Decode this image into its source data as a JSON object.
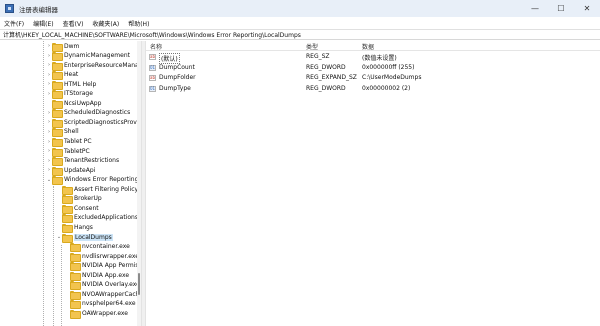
{
  "window": {
    "title": "注册表编辑器",
    "minimize": "—",
    "maximize": "☐",
    "close": "✕"
  },
  "menu": [
    "文件(F)",
    "编辑(E)",
    "查看(V)",
    "收藏夹(A)",
    "帮助(H)"
  ],
  "address": "计算机\\HKEY_LOCAL_MACHINE\\SOFTWARE\\Microsoft\\Windows\\Windows Error Reporting\\LocalDumps",
  "tree": [
    {
      "label": "Dwm",
      "level": 0,
      "expander": "›"
    },
    {
      "label": "DynamicManagement",
      "level": 0,
      "expander": "›"
    },
    {
      "label": "EnterpriseResourceManage",
      "level": 0,
      "expander": "›"
    },
    {
      "label": "Heat",
      "level": 0,
      "expander": "›"
    },
    {
      "label": "HTML Help",
      "level": 0,
      "expander": "›"
    },
    {
      "label": "ITStorage",
      "level": 0,
      "expander": "›"
    },
    {
      "label": "NcsiUwpApp",
      "level": 0,
      "expander": ""
    },
    {
      "label": "ScheduledDiagnostics",
      "level": 0,
      "expander": "›"
    },
    {
      "label": "ScriptedDiagnosticsProvide",
      "level": 0,
      "expander": "›"
    },
    {
      "label": "Shell",
      "level": 0,
      "expander": "›"
    },
    {
      "label": "Tablet PC",
      "level": 0,
      "expander": "›"
    },
    {
      "label": "TabletPC",
      "level": 0,
      "expander": "›"
    },
    {
      "label": "TenantRestrictions",
      "level": 0,
      "expander": "›"
    },
    {
      "label": "UpdateApi",
      "level": 0,
      "expander": "›"
    },
    {
      "label": "Windows Error Reporting",
      "level": 0,
      "expander": "⌄"
    },
    {
      "label": "Assert Filtering Policy",
      "level": 1,
      "expander": ""
    },
    {
      "label": "BrokerUp",
      "level": 1,
      "expander": ""
    },
    {
      "label": "Consent",
      "level": 1,
      "expander": ""
    },
    {
      "label": "ExcludedApplications",
      "level": 1,
      "expander": ""
    },
    {
      "label": "Hangs",
      "level": 1,
      "expander": ""
    },
    {
      "label": "LocalDumps",
      "level": 1,
      "expander": "⌄",
      "selected": true
    },
    {
      "label": "nvcontainer.exe",
      "level": 2,
      "expander": ""
    },
    {
      "label": "nvdlisrwrapper.exe",
      "level": 2,
      "expander": ""
    },
    {
      "label": "NVIDIA App Permissic",
      "level": 2,
      "expander": ""
    },
    {
      "label": "NVIDIA App.exe",
      "level": 2,
      "expander": ""
    },
    {
      "label": "NVIDIA Overlay.exe",
      "level": 2,
      "expander": ""
    },
    {
      "label": "NVOAWrapperCache.e",
      "level": 2,
      "expander": ""
    },
    {
      "label": "nvsphelper64.exe",
      "level": 2,
      "expander": ""
    },
    {
      "label": "OAWrapper.exe",
      "level": 2,
      "expander": ""
    }
  ],
  "columns": {
    "name": "名称",
    "type": "类型",
    "data": "数据"
  },
  "values": [
    {
      "name": "(默认)",
      "type": "REG_SZ",
      "data": "(数值未设置)",
      "icon": "ab"
    },
    {
      "name": "DumpCount",
      "type": "REG_DWORD",
      "data": "0x000000ff (255)",
      "icon": "bin"
    },
    {
      "name": "DumpFolder",
      "type": "REG_EXPAND_SZ",
      "data": "C:\\UserModeDumps",
      "icon": "ab"
    },
    {
      "name": "DumpType",
      "type": "REG_DWORD",
      "data": "0x00000002 (2)",
      "icon": "bin"
    }
  ]
}
